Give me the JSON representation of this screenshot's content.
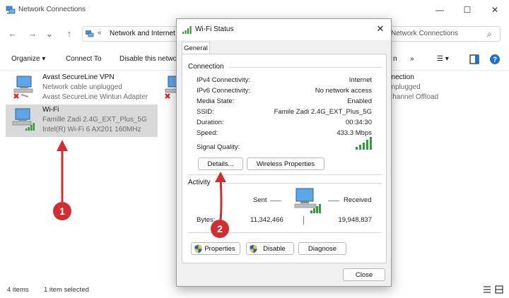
{
  "window": {
    "title": "Network Connections",
    "minimize": "—",
    "maximize": "☐",
    "close": "✕"
  },
  "nav": {
    "back": "←",
    "forward": "→",
    "recent": "⌄",
    "up": "↑"
  },
  "address": {
    "separator": "«",
    "path": "Network and Internet"
  },
  "search": {
    "text": "Network Connections",
    "icon": "⌕"
  },
  "toolbar": {
    "organize": "Organize ▾",
    "connect_to": "Connect To",
    "disable": "Disable this netwo",
    "hidden_fragment": "n",
    "more": "»",
    "view_options": "☰ ▾"
  },
  "connections": [
    {
      "name": "Avast SecureLine VPN",
      "line1": "Network cable unplugged",
      "line2": "Avast SecureLine Wintun Adapter"
    },
    {
      "name": "Wi-Fi",
      "line1": "Famille Zadi 2.4G_EXT_Plus_5G",
      "line2": "Intel(R) Wi-Fi 6 AX201 160MHz"
    },
    {
      "name": "nnection",
      "line1": "unplugged",
      "line2": "Channel Offload"
    }
  ],
  "statusbar": {
    "items_count": "4 items",
    "selected": "1 item selected"
  },
  "dialog": {
    "title": "Wi-Fi Status",
    "close": "✕",
    "tab": "General",
    "connection": {
      "label": "Connection",
      "rows": [
        {
          "label": "IPv4 Connectivity:",
          "value": "Internet"
        },
        {
          "label": "IPv6 Connectivity:",
          "value": "No network access"
        },
        {
          "label": "Media State:",
          "value": "Enabled"
        },
        {
          "label": "SSID:",
          "value": "Famile Zadi 2.4G_EXT_Plus_5G"
        },
        {
          "label": "Duration:",
          "value": "00:34:30"
        },
        {
          "label": "Speed:",
          "value": "433.3 Mbps"
        }
      ],
      "signal_label": "Signal Quality:",
      "signal_bars": 5
    },
    "buttons": {
      "details": "Details...",
      "wireless_properties": "Wireless Properties",
      "properties": "Properties",
      "disable": "Disable",
      "diagnose": "Diagnose",
      "close": "Close"
    },
    "activity": {
      "label": "Activity",
      "sent_label": "Sent",
      "received_label": "Received",
      "bytes_label": "Bytes:",
      "sent_value": "11,342,466",
      "received_value": "19,948,837"
    }
  },
  "annotations": {
    "marker1": "1",
    "marker2": "2",
    "color": "#cf2f33"
  },
  "colors": {
    "selection": "#d9d9d9",
    "signal_green": "#2f9e3f",
    "accent_blue": "#1a73c7"
  }
}
